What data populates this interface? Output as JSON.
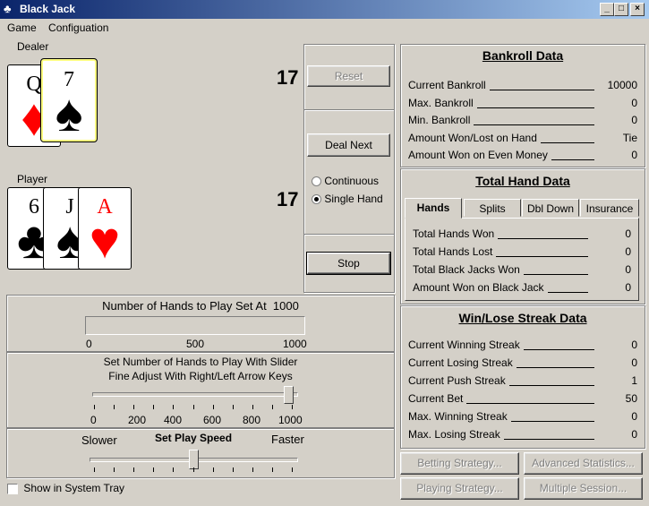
{
  "window": {
    "title": "Black Jack"
  },
  "menu": {
    "game": "Game",
    "configuration": "Configuation"
  },
  "dealer": {
    "label": "Dealer",
    "total": "17",
    "cards": [
      {
        "rank": "Q",
        "suit": "♦",
        "color": "red"
      },
      {
        "rank": "7",
        "suit": "♠",
        "color": "black"
      }
    ]
  },
  "player": {
    "label": "Player",
    "total": "17",
    "cards": [
      {
        "rank": "6",
        "suit": "♣",
        "color": "black"
      },
      {
        "rank": "J",
        "suit": "♠",
        "color": "black"
      },
      {
        "rank": "A",
        "suit": "♥",
        "color": "red"
      }
    ]
  },
  "controls": {
    "reset": "Reset",
    "deal_next": "Deal Next",
    "continuous": "Continuous",
    "single_hand": "Single Hand",
    "selected_mode": "single_hand",
    "stop": "Stop"
  },
  "hands_panel": {
    "label": "Number of Hands to Play Set At",
    "value": "1000",
    "progress": 0,
    "scale": [
      "0",
      "500",
      "1000"
    ]
  },
  "slider_panel": {
    "line1": "Set Number of Hands to Play With Slider",
    "line2": "Fine Adjust With Right/Left Arrow Keys",
    "ticks": [
      "0",
      "200",
      "400",
      "600",
      "800",
      "1000"
    ],
    "value_fraction": 1.0
  },
  "speed_panel": {
    "slower": "Slower",
    "label": "Set Play Speed",
    "faster": "Faster",
    "value_fraction": 0.5
  },
  "tray": {
    "label": "Show in System Tray",
    "checked": false
  },
  "bankroll": {
    "title": "Bankroll Data",
    "rows": [
      {
        "label": "Current Bankroll",
        "value": "10000"
      },
      {
        "label": "Max. Bankroll",
        "value": "0"
      },
      {
        "label": "Min. Bankroll",
        "value": "0"
      },
      {
        "label": "Amount Won/Lost on Hand",
        "value": "Tie"
      },
      {
        "label": "Amount Won on Even Money",
        "value": "0"
      }
    ]
  },
  "total_hand": {
    "title": "Total Hand Data",
    "tabs": [
      "Hands",
      "Splits",
      "Dbl Down",
      "Insurance"
    ],
    "active_tab": "Hands",
    "rows": [
      {
        "label": "Total Hands Won",
        "value": "0"
      },
      {
        "label": "Total Hands Lost",
        "value": "0"
      },
      {
        "label": "Total Black Jacks Won",
        "value": "0"
      },
      {
        "label": "Amount Won on Black Jack",
        "value": "0"
      }
    ]
  },
  "streak": {
    "title": "Win/Lose Streak Data",
    "rows": [
      {
        "label": "Current Winning Streak",
        "value": "0"
      },
      {
        "label": "Current Losing Streak",
        "value": "0"
      },
      {
        "label": "Current Push Streak",
        "value": "1"
      },
      {
        "label": "Current Bet",
        "value": "50"
      },
      {
        "label": "Max. Winning Streak",
        "value": "0"
      },
      {
        "label": "Max. Losing Streak",
        "value": "0"
      }
    ]
  },
  "bottom_buttons": {
    "betting": "Betting Strategy...",
    "advanced": "Advanced Statistics...",
    "playing": "Playing Strategy...",
    "multiple": "Multiple Session..."
  }
}
